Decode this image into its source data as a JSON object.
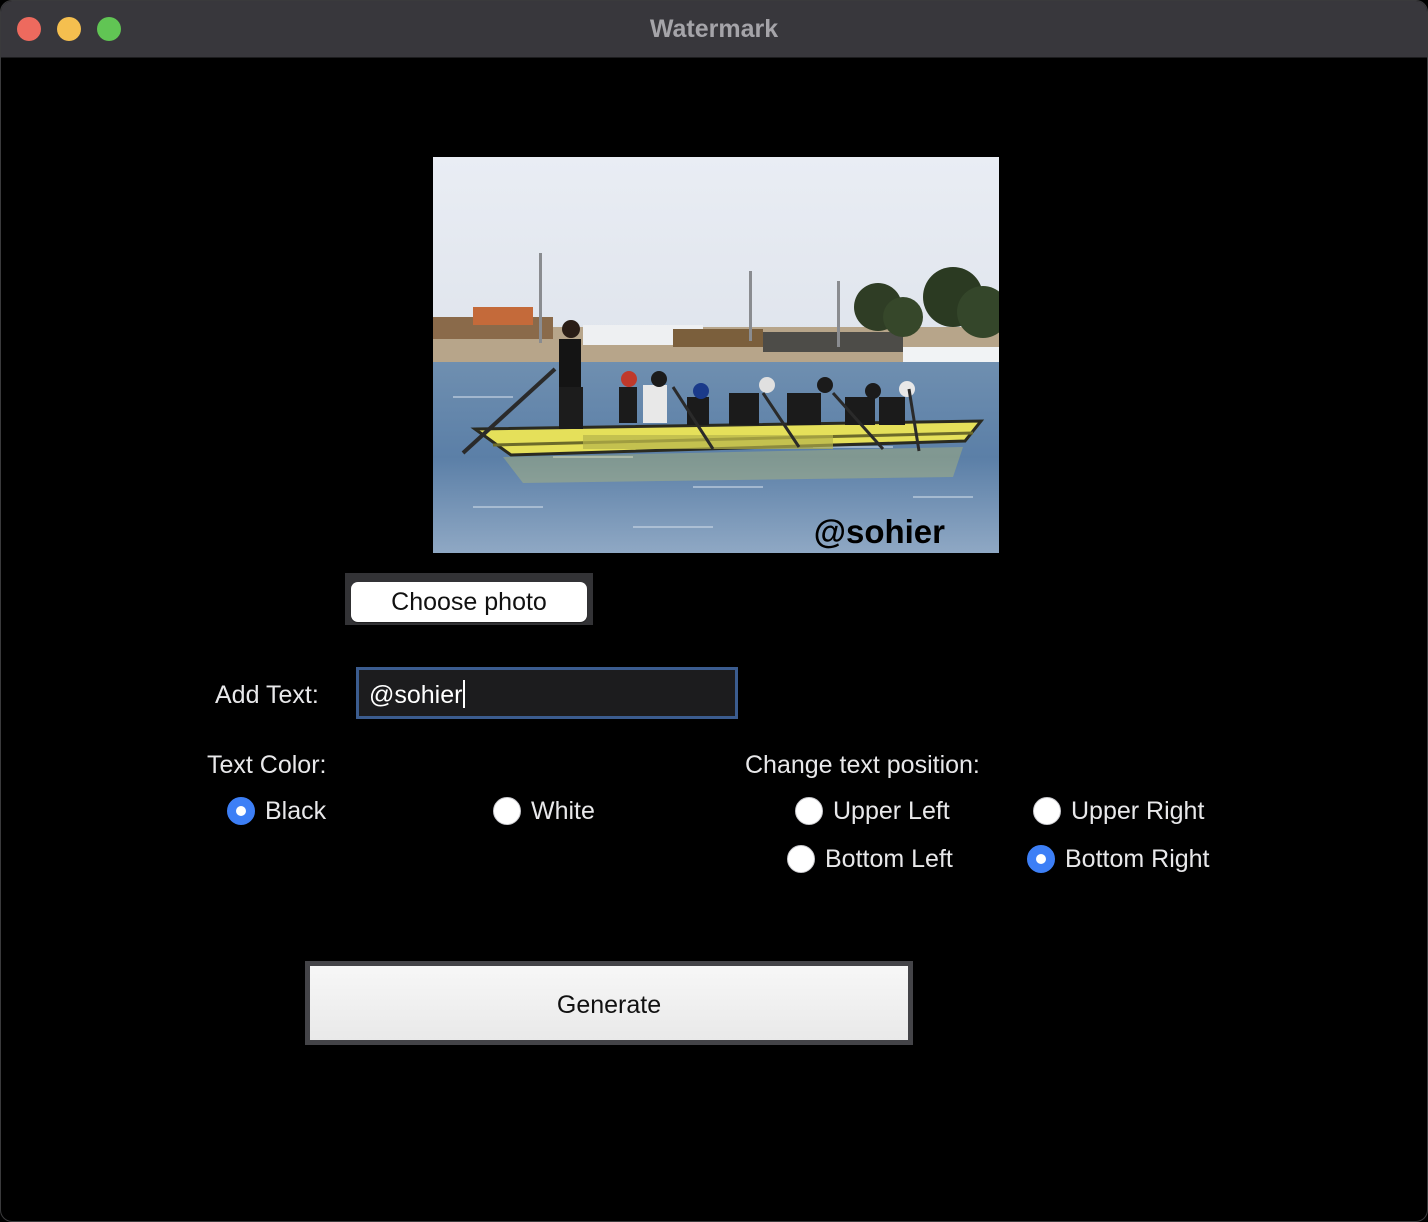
{
  "window": {
    "title": "Watermark"
  },
  "preview": {
    "watermark_text": "@sohier"
  },
  "buttons": {
    "choose_photo": "Choose photo",
    "generate": "Generate"
  },
  "text_field": {
    "label": "Add Text:",
    "value": "@sohier"
  },
  "text_color": {
    "label": "Text Color:",
    "options": [
      {
        "label": "Black",
        "selected": true
      },
      {
        "label": "White",
        "selected": false
      }
    ]
  },
  "position": {
    "label": "Change text position:",
    "options": [
      {
        "label": "Upper Left",
        "selected": false
      },
      {
        "label": "Upper Right",
        "selected": false
      },
      {
        "label": "Bottom Left",
        "selected": false
      },
      {
        "label": "Bottom Right",
        "selected": true
      }
    ]
  },
  "colors": {
    "accent": "#3d7ff6",
    "titlebar": "#38373c",
    "background": "#000000"
  }
}
